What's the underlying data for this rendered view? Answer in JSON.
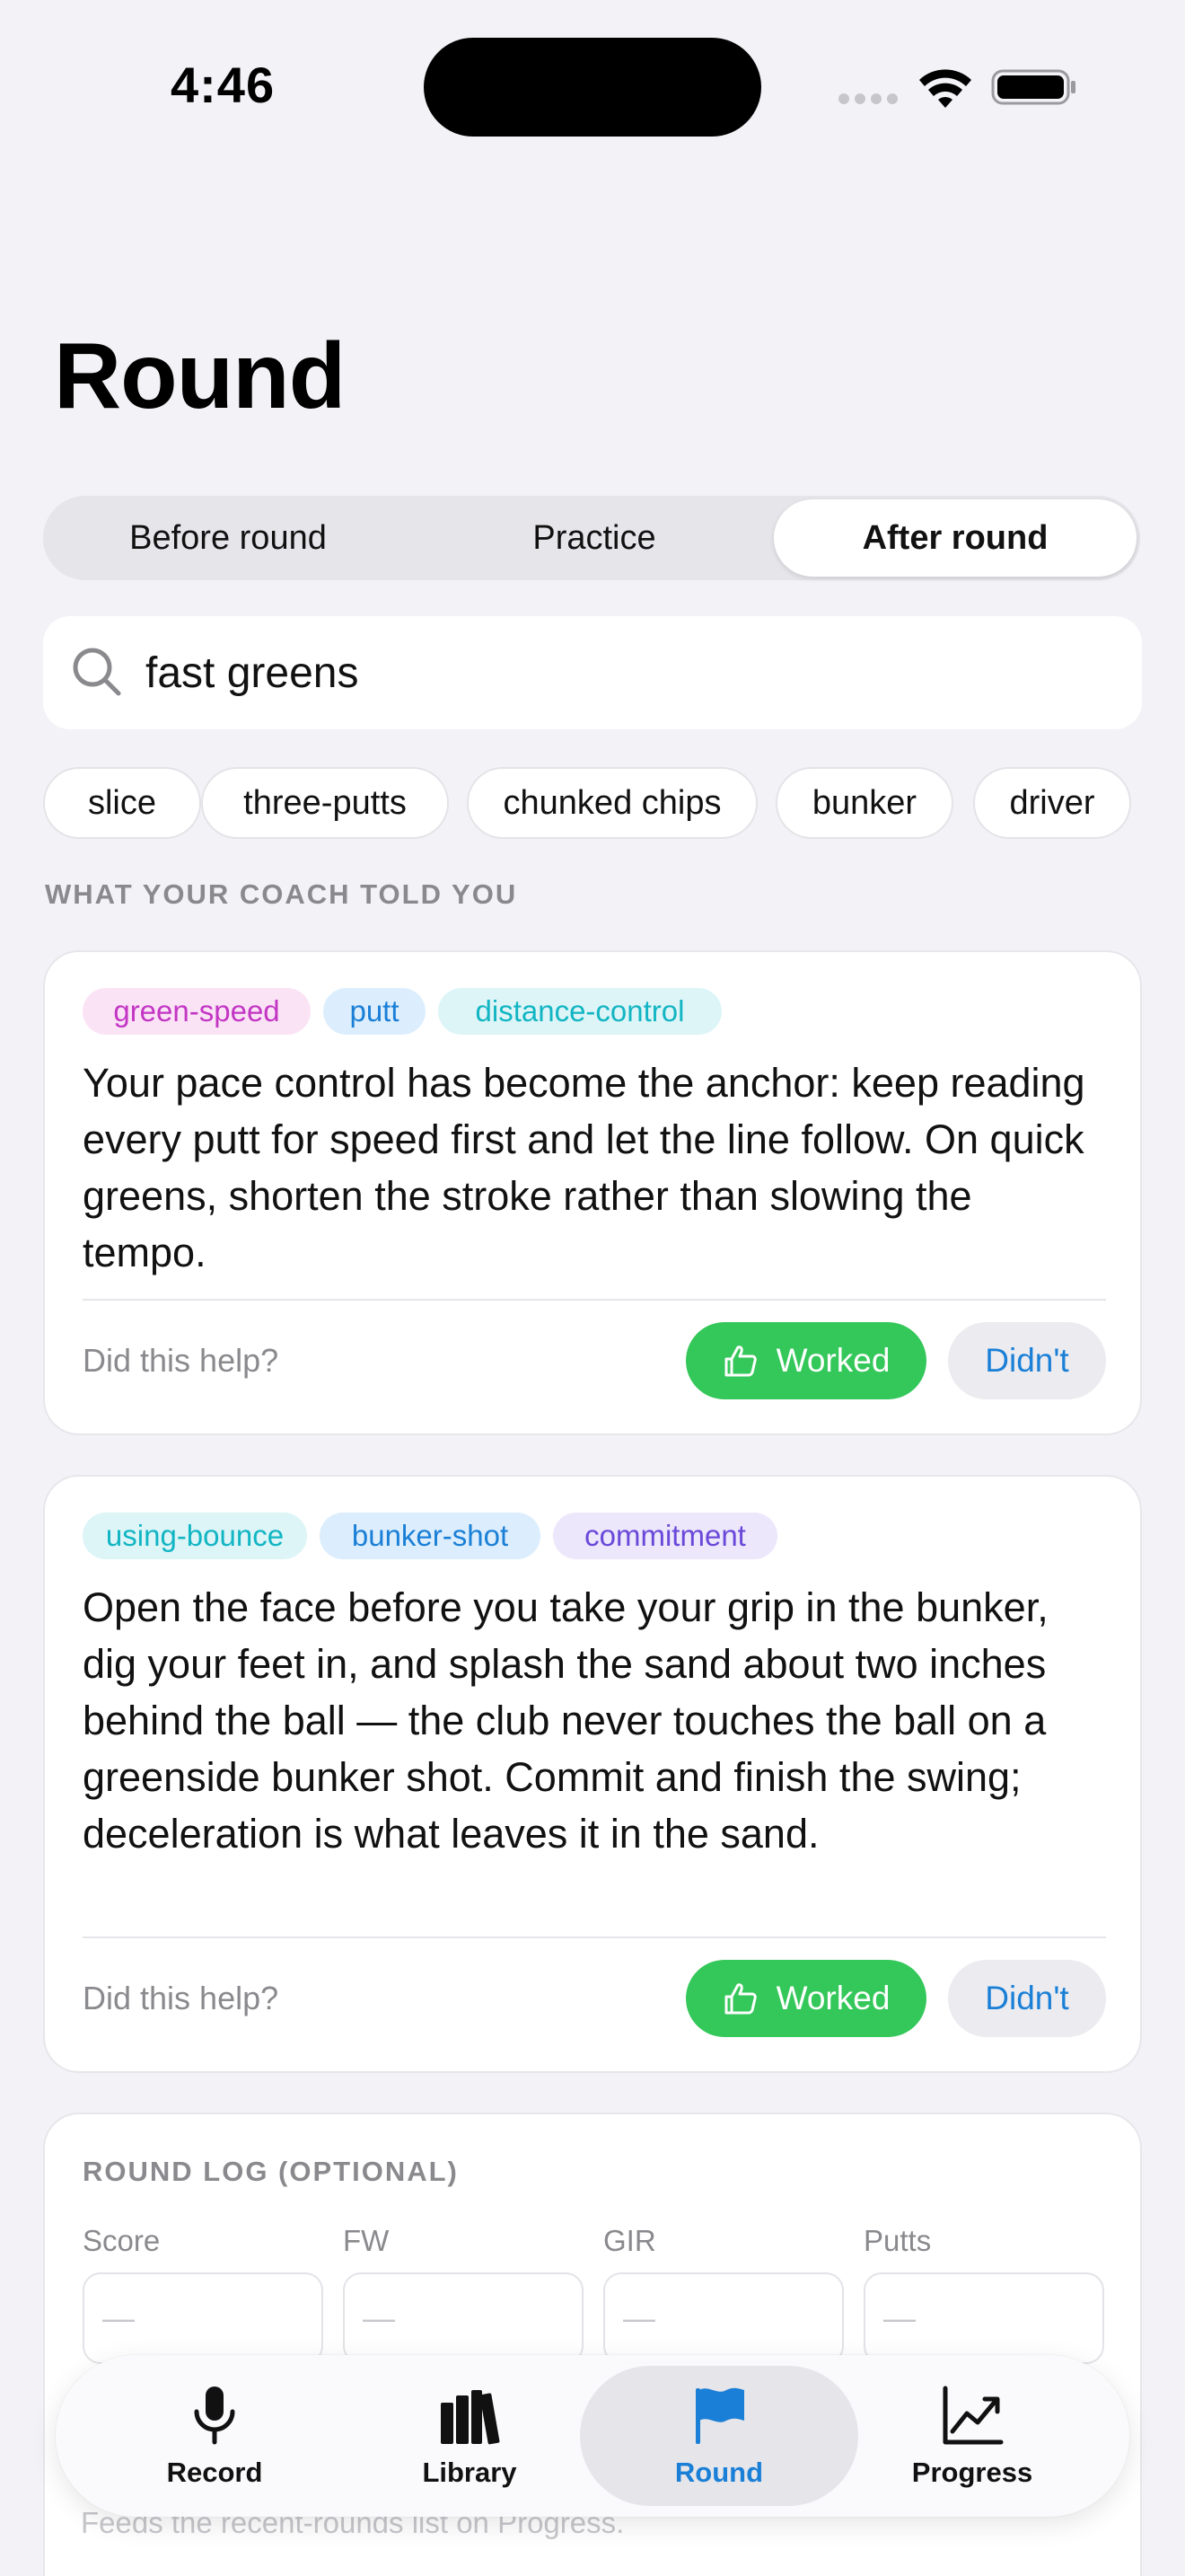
{
  "status_bar": {
    "time": "4:46"
  },
  "page": {
    "title": "Round"
  },
  "segments": [
    "Before round",
    "Practice",
    "After round"
  ],
  "selected_segment": "After round",
  "search": {
    "value": "fast greens"
  },
  "chips": [
    "slice",
    "three-putts",
    "chunked chips",
    "bunker",
    "driver"
  ],
  "section_label": "WHAT YOUR COACH TOLD YOU",
  "cards": [
    {
      "tags": [
        "green-speed",
        "putt",
        "distance-control"
      ],
      "text": "Your pace control has become the anchor: keep reading every putt for speed first and let the line follow. On quick greens, shorten the stroke rather than slowing the tempo.",
      "help_label": "Did this help?",
      "worked_label": "Worked",
      "didnt_label": "Didn't"
    },
    {
      "tags": [
        "using-bounce",
        "bunker-shot",
        "commitment"
      ],
      "text": "Open the face before you take your grip in the bunker, dig your feet in, and splash the sand about two inches behind the ball — the club never touches the ball on a greenside bunker shot. Commit and finish the swing; deceleration is what leaves it in the sand.",
      "help_label": "Did this help?",
      "worked_label": "Worked",
      "didnt_label": "Didn't"
    }
  ],
  "round_log": {
    "title": "ROUND LOG (OPTIONAL)",
    "fields": [
      {
        "label": "Score",
        "placeholder": "—"
      },
      {
        "label": "FW",
        "placeholder": "—"
      },
      {
        "label": "GIR",
        "placeholder": "—"
      },
      {
        "label": "Putts",
        "placeholder": "—"
      }
    ],
    "note": "Feeds the recent-rounds list on Progress."
  },
  "tabbar": {
    "tabs": [
      {
        "label": "Record",
        "icon": "microphone-icon"
      },
      {
        "label": "Library",
        "icon": "books-icon"
      },
      {
        "label": "Round",
        "icon": "flag-icon"
      },
      {
        "label": "Progress",
        "icon": "chart-line-icon"
      }
    ],
    "active": "Round"
  },
  "colors": {
    "accent": "#1A7FD6",
    "worked": "#34C759",
    "background": "#F2F2F7"
  }
}
